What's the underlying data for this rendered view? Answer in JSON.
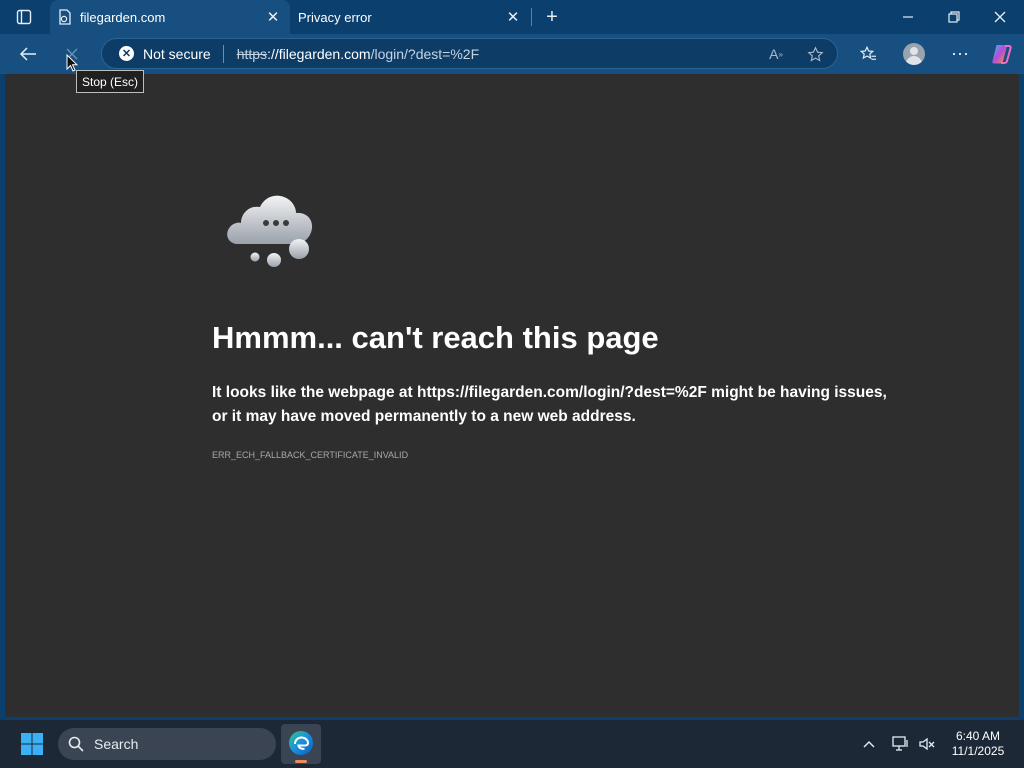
{
  "browser": {
    "tabs": [
      {
        "title": "filegarden.com",
        "active": true
      },
      {
        "title": "Privacy error",
        "active": false
      }
    ],
    "address_bar": {
      "security_label": "Not secure",
      "url_scheme": "https",
      "url_host": "://filegarden.com",
      "url_path": "/login/?dest=%2F"
    },
    "tooltip": "Stop (Esc)"
  },
  "page": {
    "heading": "Hmmm... can't reach this page",
    "text_before": "It looks like the webpage at ",
    "text_url": "https://filegarden.com/login/?dest=%2F",
    "text_after": " might be having issues, or it may have moved permanently to a new web address.",
    "error_code": "ERR_ECH_FALLBACK_CERTIFICATE_INVALID"
  },
  "taskbar": {
    "search_label": "Search",
    "time": "6:40 AM",
    "date": "11/1/2025"
  },
  "colors": {
    "titlebar": "#0b3f6e",
    "toolbar": "#174f80",
    "page_bg": "#2e2e2e",
    "taskbar": "#1d2837"
  }
}
